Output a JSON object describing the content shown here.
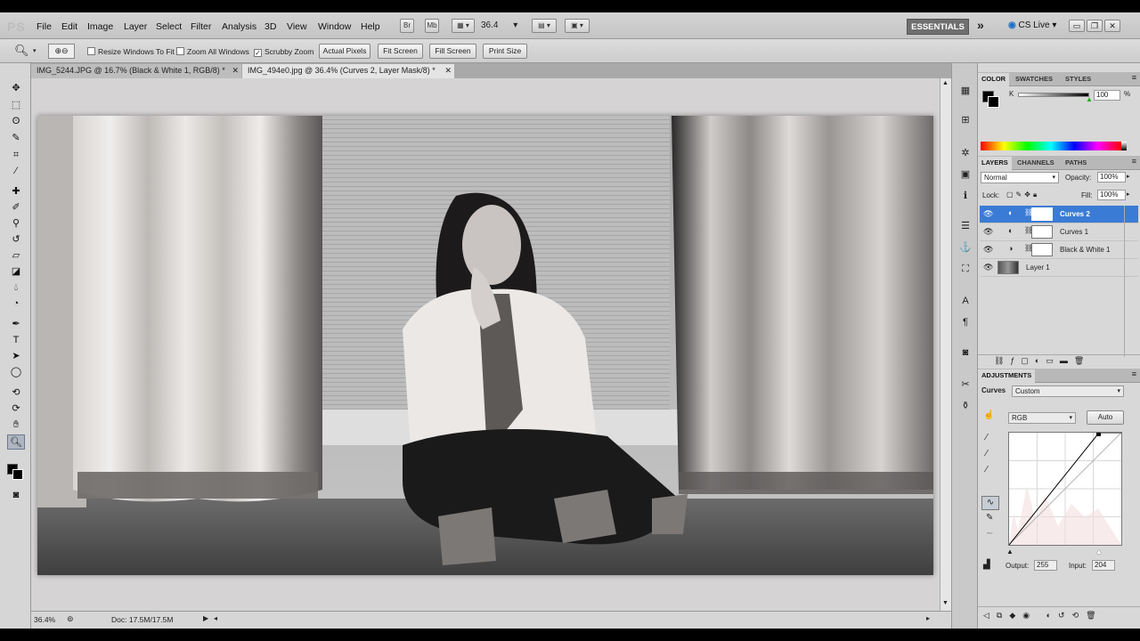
{
  "app": {
    "logo": "PS",
    "menus": [
      "File",
      "Edit",
      "Image",
      "Layer",
      "Select",
      "Filter",
      "Analysis",
      "3D",
      "View",
      "Window",
      "Help"
    ],
    "bridge_label": "Br",
    "minibridge_label": "Mb",
    "zoom_value": "36.4",
    "workspace": "ESSENTIALS",
    "cs_live": "CS Live",
    "overflow": "»"
  },
  "options": {
    "resize_windows": "Resize Windows To Fit",
    "zoom_all": "Zoom All Windows",
    "scrubby_zoom": "Scrubby Zoom",
    "actual_pixels": "Actual Pixels",
    "fit_screen": "Fit Screen",
    "fill_screen": "Fill Screen",
    "print_size": "Print Size"
  },
  "tabs": [
    {
      "label": "IMG_5244.JPG @ 16.7% (Black & White 1, RGB/8) *"
    },
    {
      "label": "IMG_494e0.jpg @ 36.4% (Curves 2, Layer Mask/8) *"
    }
  ],
  "status": {
    "zoom": "36.4%",
    "doc": "Doc: 17.5M/17.5M"
  },
  "color_panel": {
    "tabs": [
      "COLOR",
      "SWATCHES",
      "STYLES"
    ],
    "k_label": "K",
    "k_value": "100",
    "percent": "%",
    "k_level": 1.0
  },
  "layers_panel": {
    "tabs": [
      "LAYERS",
      "CHANNELS",
      "PATHS"
    ],
    "blend_mode": "Normal",
    "opacity_label": "Opacity:",
    "opacity": "100%",
    "lock_label": "Lock:",
    "fill_label": "Fill:",
    "fill": "100%",
    "layers": [
      {
        "name": "Curves 2",
        "selected": true
      },
      {
        "name": "Curves 1",
        "selected": false
      },
      {
        "name": "Black & White 1",
        "selected": false
      },
      {
        "name": "Layer 1",
        "selected": false
      }
    ]
  },
  "adjustments_panel": {
    "tab": "ADJUSTMENTS",
    "type_label": "Curves",
    "preset": "Custom",
    "channel": "RGB",
    "auto": "Auto",
    "output_label": "Output:",
    "output": "255",
    "input_label": "Input:",
    "input": "204"
  },
  "colors": {
    "selection": "#3a7bd5",
    "menubar": "#cccccc"
  }
}
